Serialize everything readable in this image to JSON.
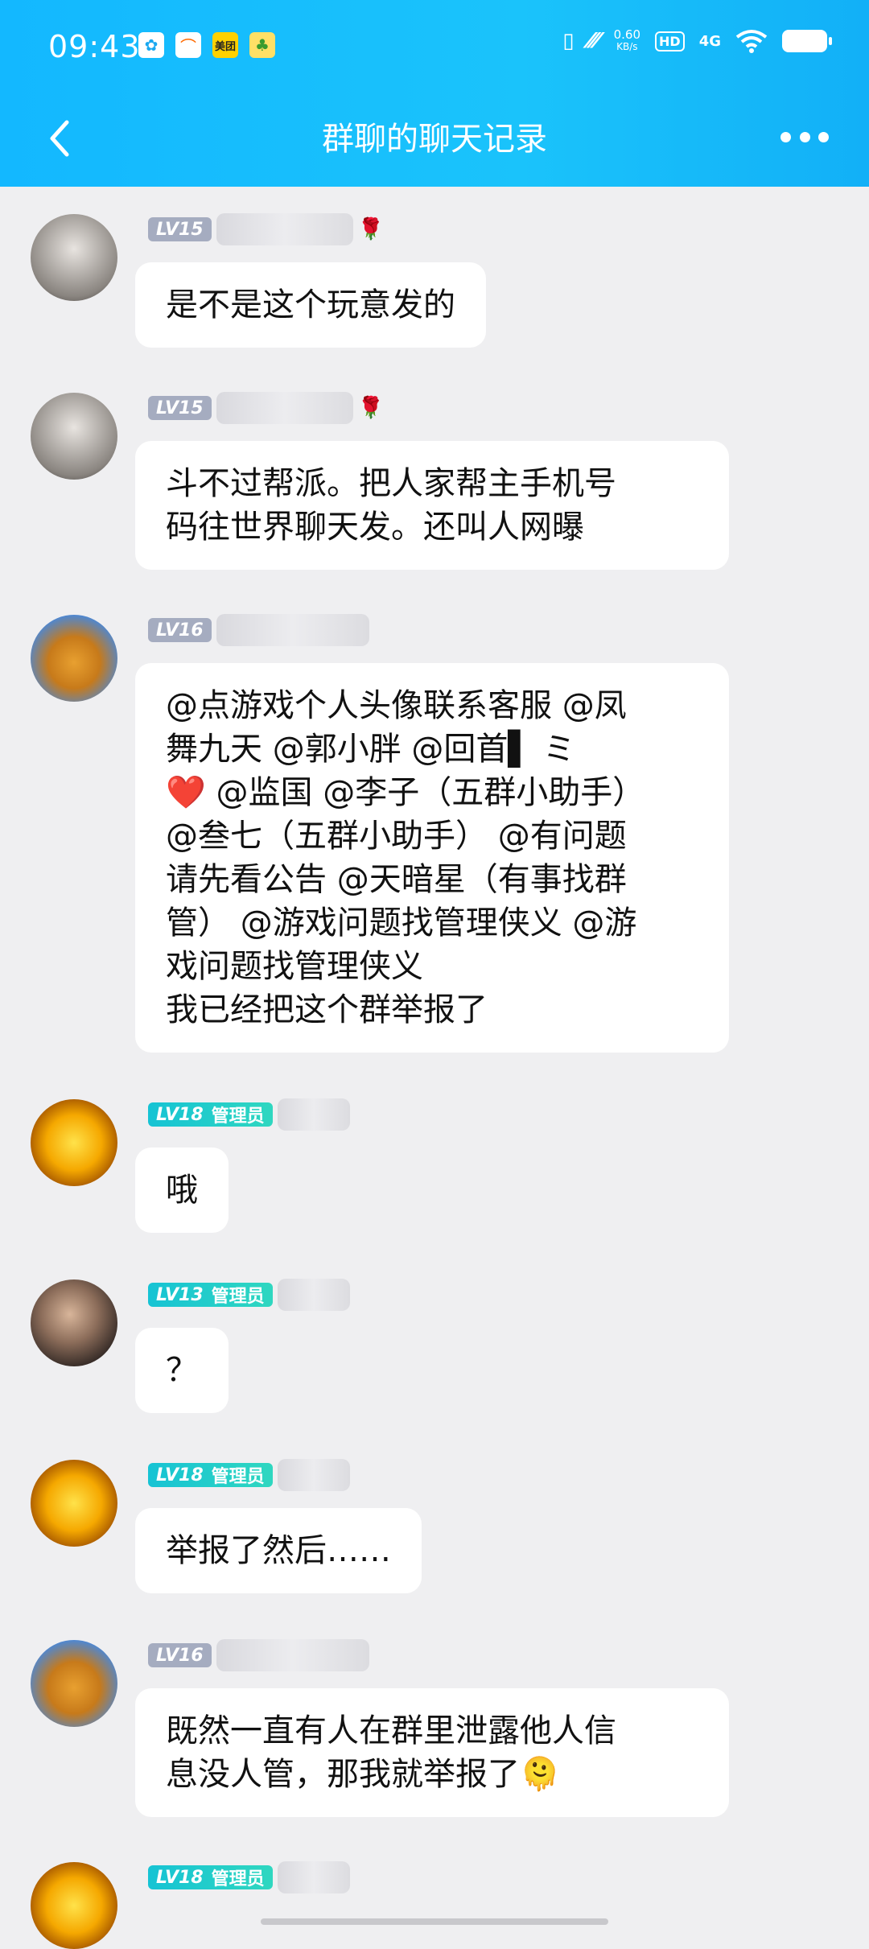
{
  "status_bar": {
    "time": "09:43",
    "app_icons": [
      "美团"
    ],
    "net_speed_value": "0.60",
    "net_speed_unit": "KB/s",
    "hd": "HD",
    "signal": "4G"
  },
  "nav": {
    "title": "群聊的聊天记录"
  },
  "messages": [
    {
      "level": "LV15",
      "role": "",
      "lines": [
        "是不是这个玩意发的"
      ]
    },
    {
      "level": "LV15",
      "role": "",
      "lines": [
        "斗不过帮派。把人家帮主手机号",
        "码往世界聊天发。还叫人网曝"
      ]
    },
    {
      "level": "LV16",
      "role": "",
      "lines": [
        "@点游戏个人头像联系客服 @凤",
        "舞九天 @郭小胖 @回首▌ ミ",
        "❤️ @监国 @李子（五群小助手）",
        "@叁七（五群小助手） @有问题",
        "请先看公告 @天暗星（有事找群",
        "管） @游戏问题找管理侠义 @游",
        "戏问题找管理侠义",
        "我已经把这个群举报了"
      ]
    },
    {
      "level": "LV18",
      "role": "管理员",
      "lines": [
        "哦"
      ]
    },
    {
      "level": "LV13",
      "role": "管理员",
      "lines": [
        "？"
      ]
    },
    {
      "level": "LV18",
      "role": "管理员",
      "lines": [
        "举报了然后……"
      ]
    },
    {
      "level": "LV16",
      "role": "",
      "lines": [
        "既然一直有人在群里泄露他人信",
        "息没人管，那我就举报了🫠"
      ]
    },
    {
      "level": "LV18",
      "role": "管理员",
      "lines": []
    }
  ],
  "colors": {
    "header": "#13b8ff",
    "background": "#efeff1",
    "admin_badge": "#16c3d4",
    "level_badge": "#a5acc0"
  }
}
